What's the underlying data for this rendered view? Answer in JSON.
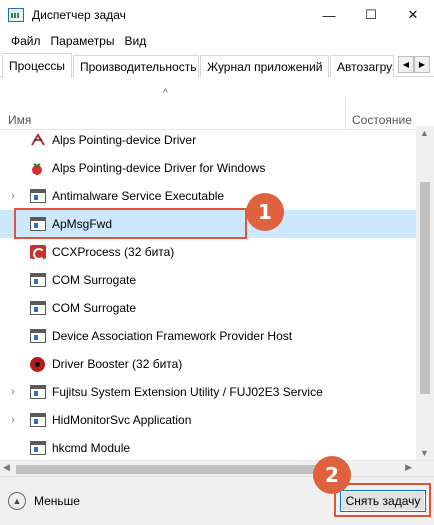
{
  "window": {
    "title": "Диспетчер задач",
    "minimize": "—",
    "maximize": "☐",
    "close": "✕"
  },
  "menu": [
    "Файл",
    "Параметры",
    "Вид"
  ],
  "tabs": [
    {
      "label": "Процессы",
      "active": true
    },
    {
      "label": "Производительность",
      "active": false
    },
    {
      "label": "Журнал приложений",
      "active": false
    },
    {
      "label": "Автозагрузка",
      "active": false
    }
  ],
  "tab_arrows": {
    "left": "◀",
    "right": "▶"
  },
  "columns": {
    "sort_indicator": "^",
    "name": "Имя",
    "status": "Состояние"
  },
  "processes": [
    {
      "name": "Alps Pointing-device Driver",
      "icon": "alps-icon",
      "expandable": false,
      "selected": false
    },
    {
      "name": "Alps Pointing-device Driver for Windows",
      "icon": "berry-icon",
      "expandable": false,
      "selected": false
    },
    {
      "name": "Antimalware Service Executable",
      "icon": "window-icon",
      "expandable": true,
      "selected": false
    },
    {
      "name": "ApMsgFwd",
      "icon": "window-icon",
      "expandable": false,
      "selected": true
    },
    {
      "name": "CCXProcess (32 бита)",
      "icon": "creative-cloud-icon",
      "expandable": false,
      "selected": false
    },
    {
      "name": "COM Surrogate",
      "icon": "window-icon",
      "expandable": false,
      "selected": false
    },
    {
      "name": "COM Surrogate",
      "icon": "window-icon",
      "expandable": false,
      "selected": false
    },
    {
      "name": "Device Association Framework Provider Host",
      "icon": "window-icon",
      "expandable": false,
      "selected": false
    },
    {
      "name": "Driver Booster (32 бита)",
      "icon": "driver-booster-icon",
      "expandable": false,
      "selected": false
    },
    {
      "name": "Fujitsu System Extension Utility / FUJ02E3 Service",
      "icon": "window-icon",
      "expandable": true,
      "selected": false
    },
    {
      "name": "HidMonitorSvc Application",
      "icon": "window-icon",
      "expandable": true,
      "selected": false
    },
    {
      "name": "hkcmd Module",
      "icon": "window-icon",
      "expandable": false,
      "selected": false
    }
  ],
  "chevron": "›",
  "footer": {
    "less_label": "Меньше",
    "less_glyph": "▲",
    "end_task_label": "Снять задачу"
  },
  "annotations": [
    {
      "number": "1"
    },
    {
      "number": "2"
    }
  ],
  "colors": {
    "selection": "#cce8ff",
    "annotation": "#e0613e",
    "button_focus": "#0078d7"
  }
}
